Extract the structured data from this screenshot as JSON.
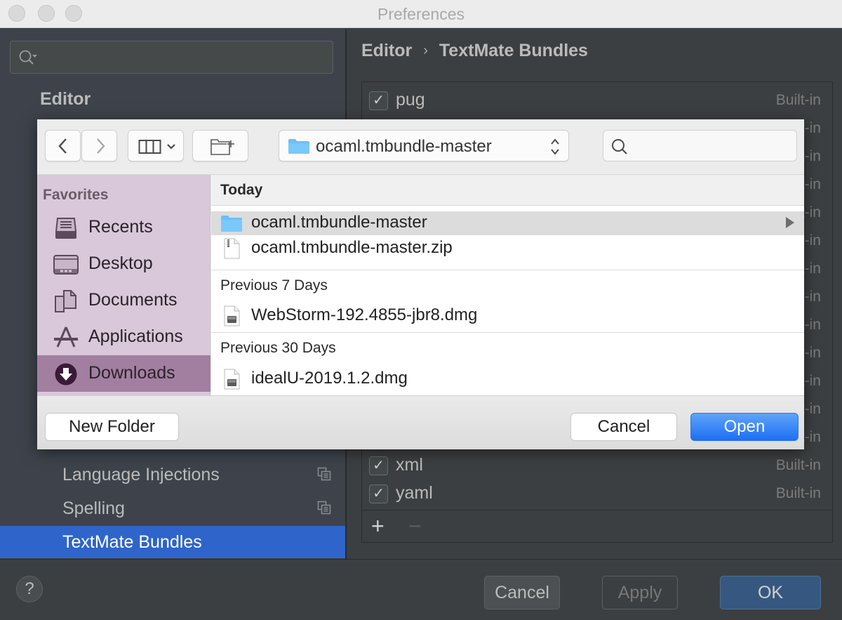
{
  "window": {
    "title": "Preferences"
  },
  "sidebar": {
    "search_placeholder": "",
    "section_title": "Editor",
    "items": [
      {
        "label": "Language Injections",
        "has_project_icon": true,
        "selected": false
      },
      {
        "label": "Spelling",
        "has_project_icon": true,
        "selected": false
      },
      {
        "label": "TextMate Bundles",
        "has_project_icon": false,
        "selected": true
      }
    ]
  },
  "main": {
    "breadcrumb": [
      "Editor",
      "TextMate Bundles"
    ],
    "breadcrumb_separator": "›",
    "bundles": [
      {
        "name": "pug",
        "checked": true,
        "source": "Built-in"
      },
      {
        "name": "",
        "checked": true,
        "source": "Built-in"
      },
      {
        "name": "",
        "checked": true,
        "source": "Built-in"
      },
      {
        "name": "",
        "checked": true,
        "source": "Built-in"
      },
      {
        "name": "",
        "checked": true,
        "source": "Built-in"
      },
      {
        "name": "",
        "checked": true,
        "source": "Built-in"
      },
      {
        "name": "",
        "checked": true,
        "source": "Built-in"
      },
      {
        "name": "",
        "checked": true,
        "source": "Built-in"
      },
      {
        "name": "",
        "checked": true,
        "source": "Built-in"
      },
      {
        "name": "",
        "checked": true,
        "source": "Built-in"
      },
      {
        "name": "",
        "checked": true,
        "source": "Built-in"
      },
      {
        "name": "",
        "checked": true,
        "source": "Built-in"
      },
      {
        "name": "",
        "checked": true,
        "source": "Built-in"
      },
      {
        "name": "xml",
        "checked": true,
        "source": "Built-in"
      },
      {
        "name": "yaml",
        "checked": true,
        "source": "Built-in"
      }
    ],
    "add_label": "+",
    "remove_label": "−"
  },
  "footer": {
    "help_label": "?",
    "cancel_label": "Cancel",
    "apply_label": "Apply",
    "ok_label": "OK"
  },
  "file_dialog": {
    "path_popup": "ocaml.tmbundle-master",
    "search_placeholder": "",
    "favorites_title": "Favorites",
    "favorites": [
      {
        "label": "Recents",
        "icon": "recents-icon",
        "selected": false
      },
      {
        "label": "Desktop",
        "icon": "desktop-icon",
        "selected": false
      },
      {
        "label": "Documents",
        "icon": "documents-icon",
        "selected": false
      },
      {
        "label": "Applications",
        "icon": "applications-icon",
        "selected": false
      },
      {
        "label": "Downloads",
        "icon": "downloads-icon",
        "selected": true
      }
    ],
    "groups": [
      {
        "title": "Today",
        "files": [
          {
            "name": "ocaml.tmbundle-master",
            "type": "folder",
            "selected": true
          },
          {
            "name": "ocaml.tmbundle-master.zip",
            "type": "zip",
            "selected": false
          }
        ]
      },
      {
        "title": "Previous 7 Days",
        "files": [
          {
            "name": "WebStorm-192.4855-jbr8.dmg",
            "type": "dmg",
            "selected": false
          }
        ]
      },
      {
        "title": "Previous 30 Days",
        "files": [
          {
            "name": "idealU-2019.1.2.dmg",
            "type": "dmg",
            "selected": false
          }
        ]
      }
    ],
    "new_folder_label": "New Folder",
    "cancel_label": "Cancel",
    "open_label": "Open"
  },
  "colors": {
    "selection_blue": "#2f65ca",
    "open_button": "#1d6ff3",
    "sidebar_purple": "#d9c8d9",
    "sidebar_selected": "#a27fa0",
    "ok_button": "#365880"
  }
}
